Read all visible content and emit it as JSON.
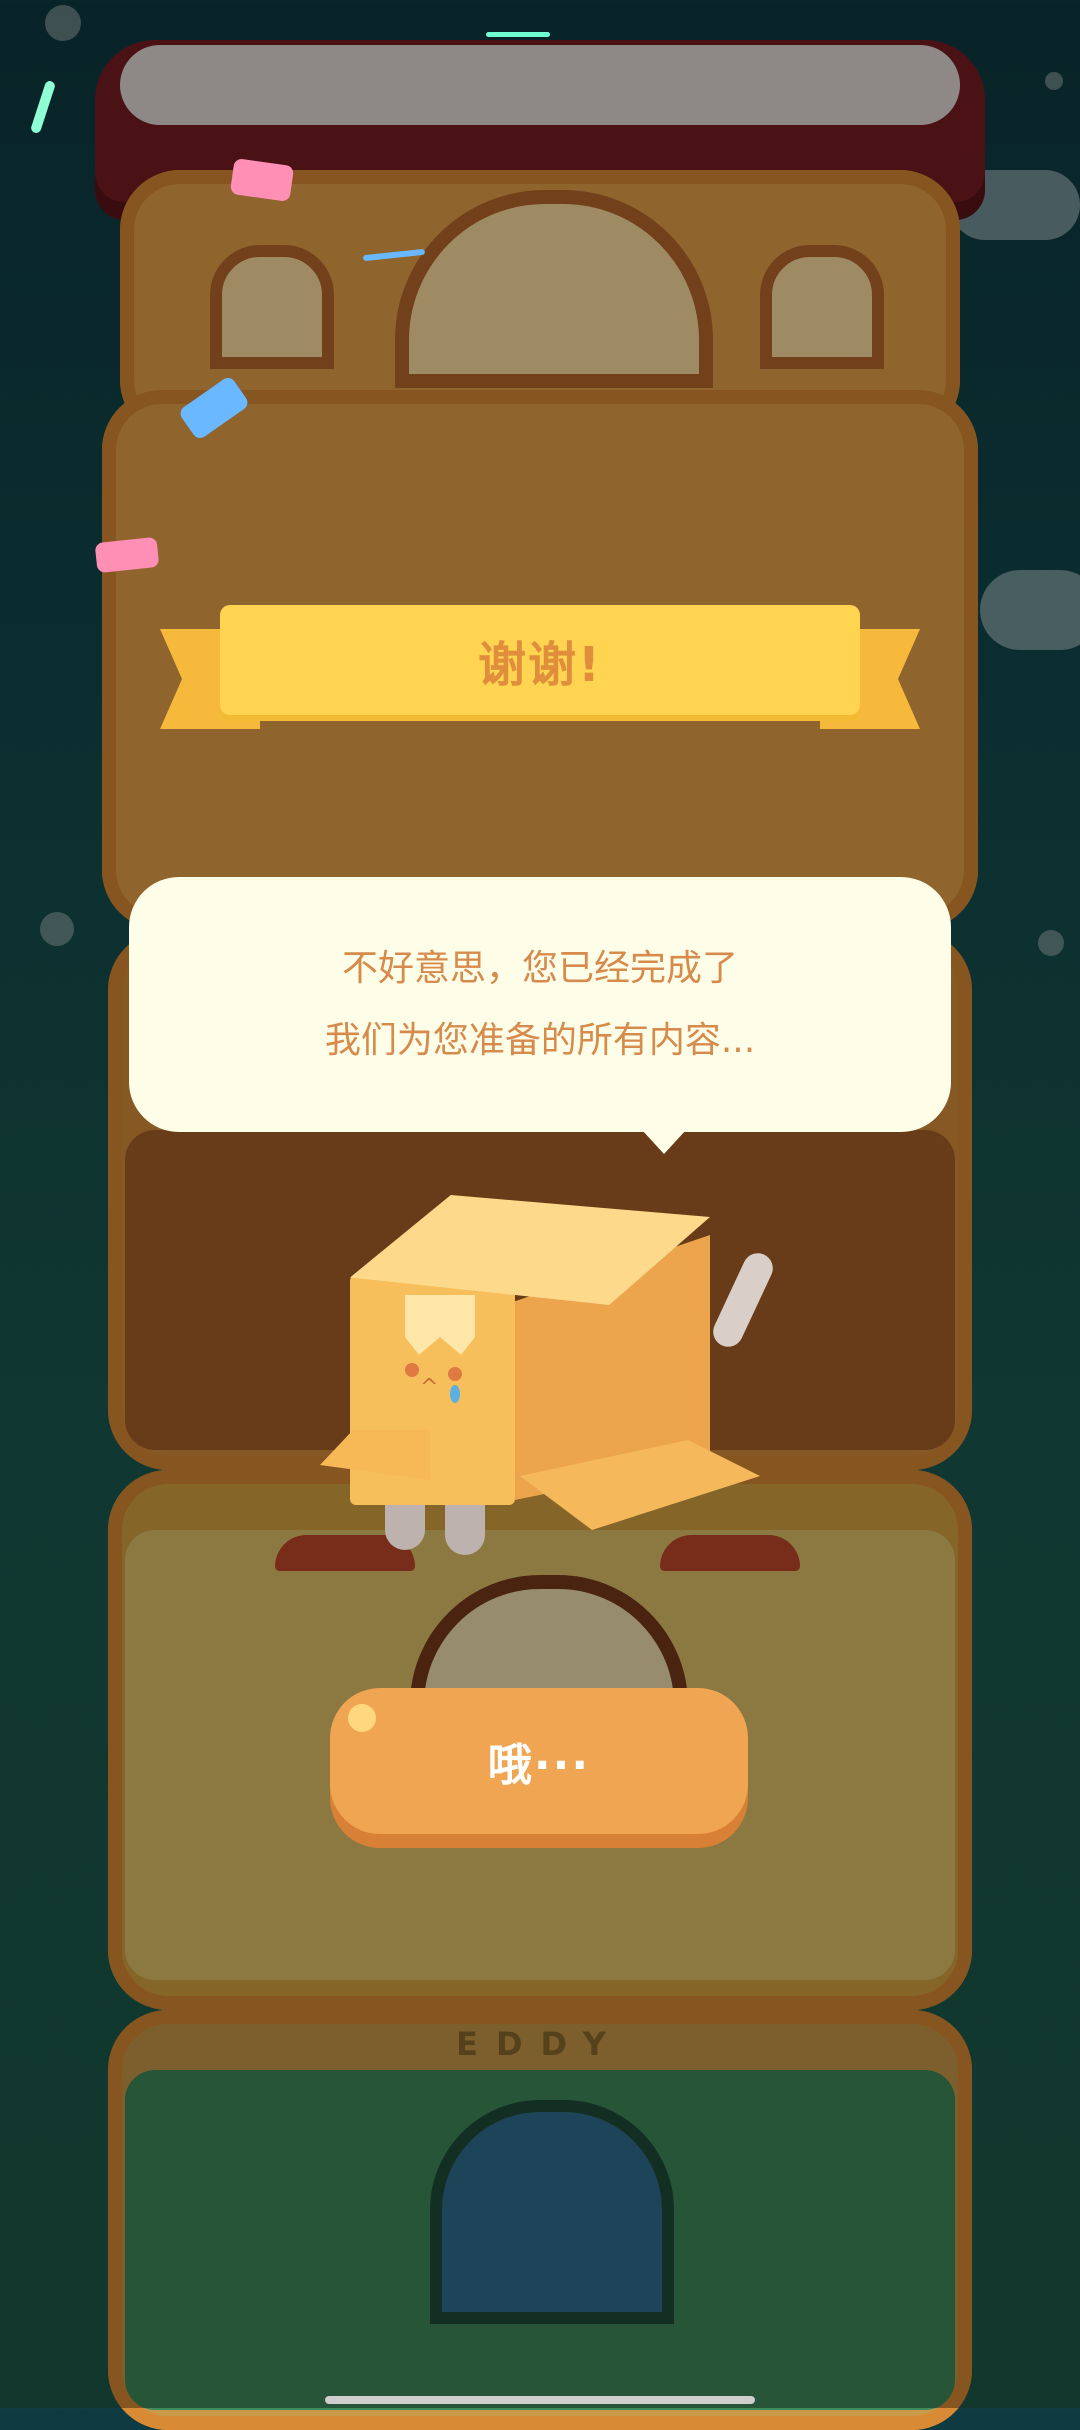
{
  "banner": {
    "title": "谢谢!"
  },
  "dialog": {
    "line1": "不好意思，您已经完成了",
    "line2": "我们为您准备的所有内容..."
  },
  "button": {
    "label": "哦···"
  },
  "background": {
    "sign_text": "EDDY"
  },
  "colors": {
    "ribbon": "#ffd450",
    "ribbon_text": "#e08d3c",
    "bubble": "#fdfde8",
    "bubble_text": "#d68a4c",
    "button": "#f0a552",
    "button_text": "#ffffff"
  },
  "icons": {
    "character": "cardboard-box-cat-icon",
    "confetti": "confetti-icon"
  }
}
